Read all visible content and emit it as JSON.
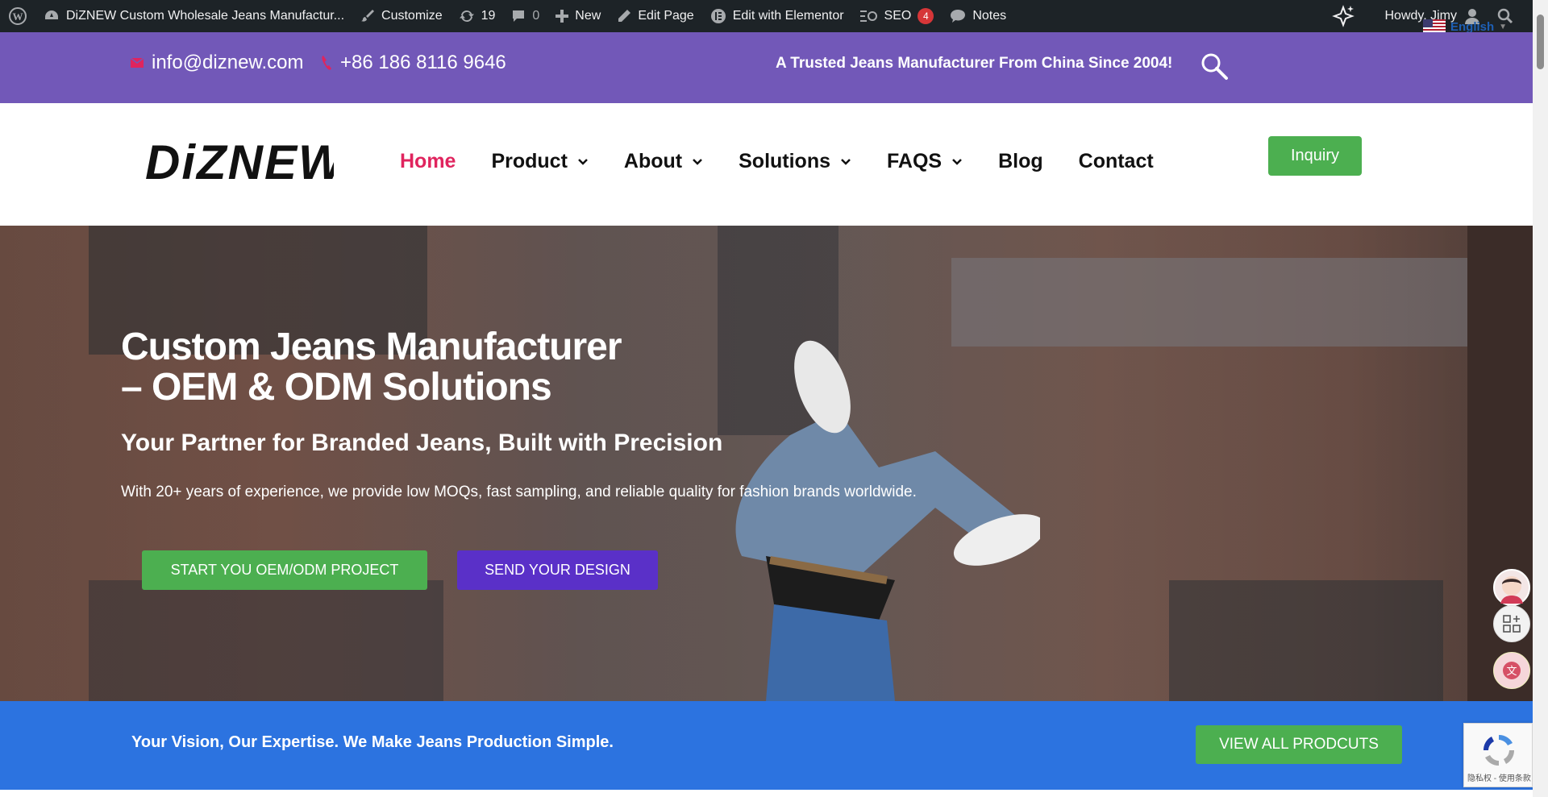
{
  "adminbar": {
    "site_title": "DiZNEW Custom Wholesale Jeans Manufactur...",
    "customize": "Customize",
    "updates": "19",
    "comments": "0",
    "new": "New",
    "edit_page": "Edit Page",
    "elementor": "Edit with Elementor",
    "seo": "SEO",
    "seo_count": "4",
    "notes": "Notes",
    "howdy": "Howdy, Jimy",
    "language": "English"
  },
  "topbar": {
    "email": "info@diznew.com",
    "phone": "+86 186 8116 9646",
    "tagline": "A Trusted Jeans Manufacturer From China Since 2004!"
  },
  "header": {
    "logo": "DiZNEW",
    "nav": [
      {
        "label": "Home"
      },
      {
        "label": "Product"
      },
      {
        "label": "About"
      },
      {
        "label": "Solutions"
      },
      {
        "label": "FAQS"
      },
      {
        "label": "Blog"
      },
      {
        "label": "Contact"
      }
    ],
    "inquiry": "Inquiry"
  },
  "hero": {
    "title_line1": "Custom Jeans Manufacturer",
    "title_line2": "– OEM & ODM Solutions",
    "subtitle": "Your Partner for Branded Jeans, Built with Precision",
    "description": "With 20+ years of experience, we provide low MOQs, fast sampling, and reliable quality for fashion brands worldwide.",
    "btn_primary": "START YOU OEM/ODM PROJECT",
    "btn_secondary": "SEND YOUR DESIGN"
  },
  "cta": {
    "text": "Your Vision, Our Expertise. We Make Jeans Production Simple.",
    "button": "VIEW ALL PRODCUTS"
  },
  "recaptcha": {
    "text": "隐私权 - 使用条款"
  },
  "colors": {
    "purple_bar": "#7258b8",
    "accent_red": "#e0245e",
    "green": "#4caf50",
    "blue_band": "#2c73e0",
    "purple_button": "#5a30c8"
  }
}
